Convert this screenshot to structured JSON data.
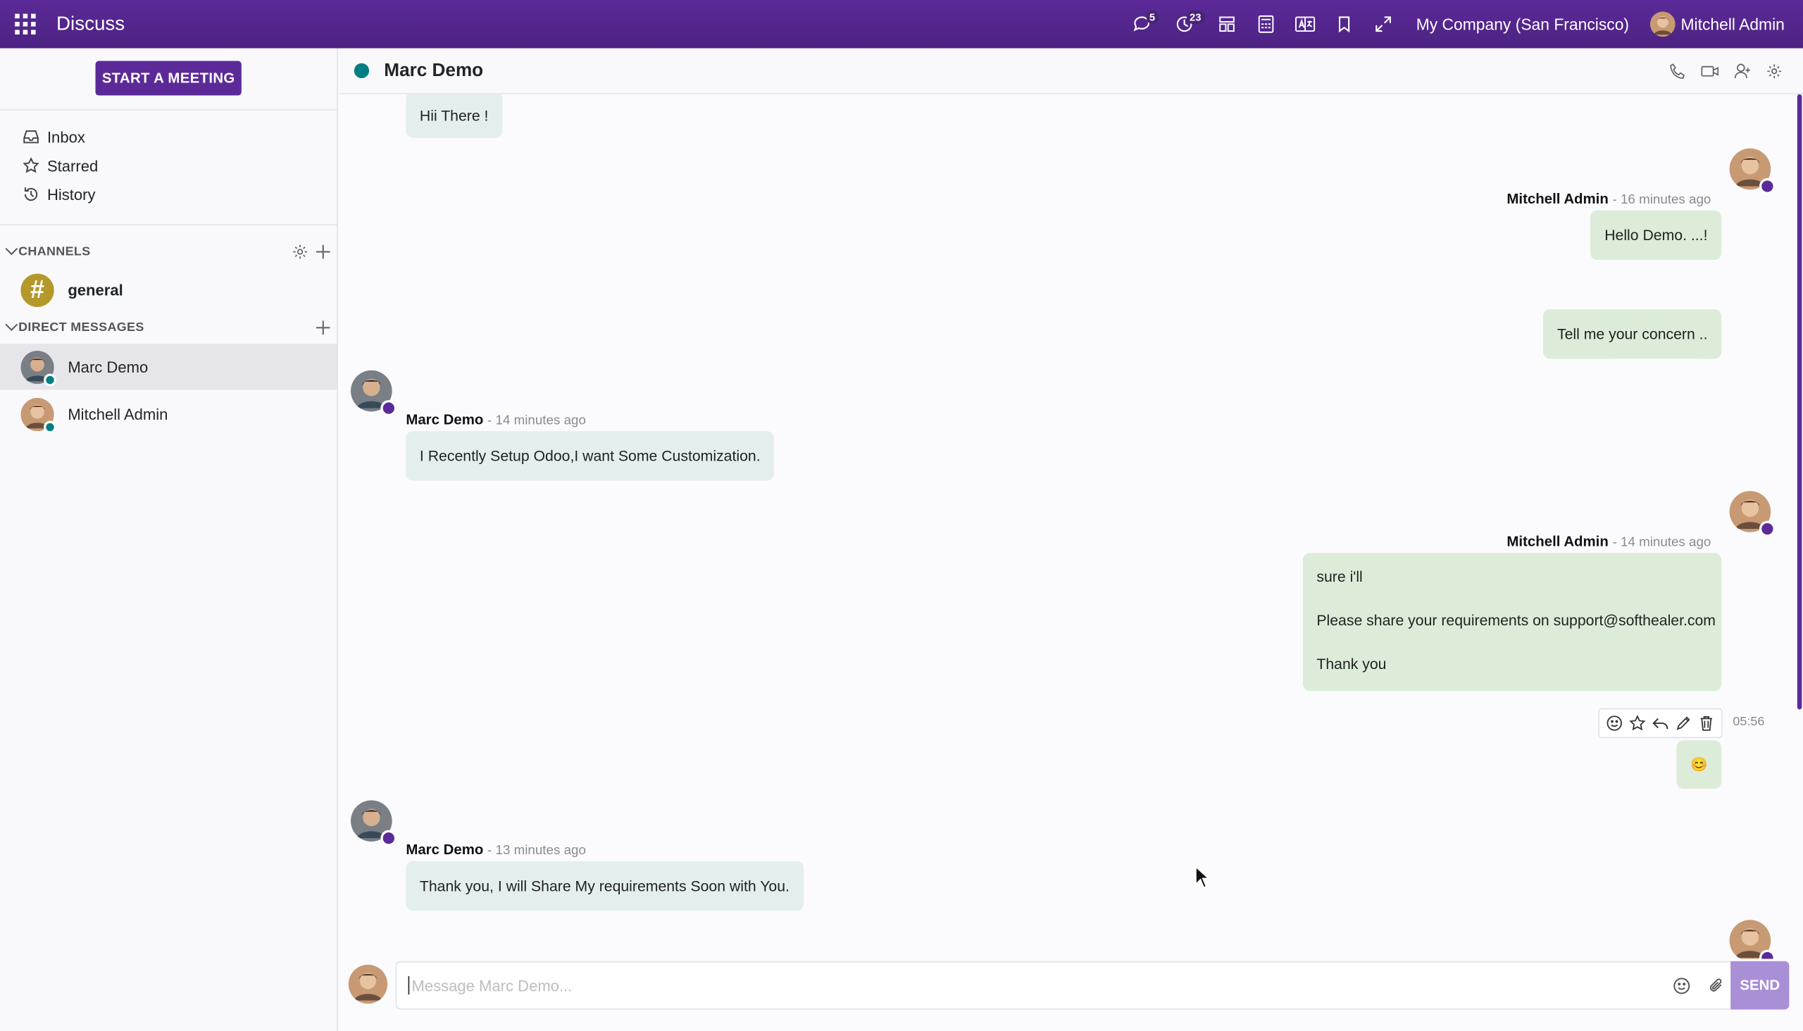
{
  "navbar": {
    "app_title": "Discuss",
    "messages_badge": "5",
    "activities_badge": "23",
    "company": "My Company (San Francisco)",
    "user": "Mitchell Admin",
    "brand_color": "#5b2a98"
  },
  "sidebar": {
    "start_meeting": "START A MEETING",
    "mailboxes": [
      {
        "label": "Inbox",
        "icon": "inbox-icon"
      },
      {
        "label": "Starred",
        "icon": "star-icon"
      },
      {
        "label": "History",
        "icon": "history-icon"
      }
    ],
    "channels_heading": "CHANNELS",
    "channels": [
      {
        "label": "general"
      }
    ],
    "dm_heading": "DIRECT MESSAGES",
    "direct_messages": [
      {
        "label": "Marc Demo",
        "active": true
      },
      {
        "label": "Mitchell Admin",
        "active": false
      }
    ]
  },
  "thread": {
    "title": "Marc Demo",
    "messages": [
      {
        "author": "",
        "time": "",
        "body": "Hii There !",
        "side": "in"
      },
      {
        "author": "Mitchell Admin",
        "time": "- 16 minutes ago",
        "body": "Hello Demo. ...!",
        "side": "out"
      },
      {
        "author": "",
        "time": "",
        "body": "Tell me your concern ..",
        "side": "out"
      },
      {
        "author": "Marc Demo",
        "time": "- 14 minutes ago",
        "body": "I Recently Setup Odoo,I want Some Customization.",
        "side": "in"
      },
      {
        "author": "Mitchell Admin",
        "time": "- 14 minutes ago",
        "lines": [
          "sure i'll",
          "Please share your requirements on support@softhealer.com",
          "Thank you"
        ],
        "side": "out"
      },
      {
        "author": "",
        "time": "05:56",
        "body": "😊",
        "side": "out"
      },
      {
        "author": "Marc Demo",
        "time": "- 13 minutes ago",
        "body": "Thank you, I will Share My requirements Soon with You.",
        "side": "in"
      }
    ]
  },
  "composer": {
    "placeholder": "Message Marc Demo...",
    "send_label": "SEND"
  }
}
